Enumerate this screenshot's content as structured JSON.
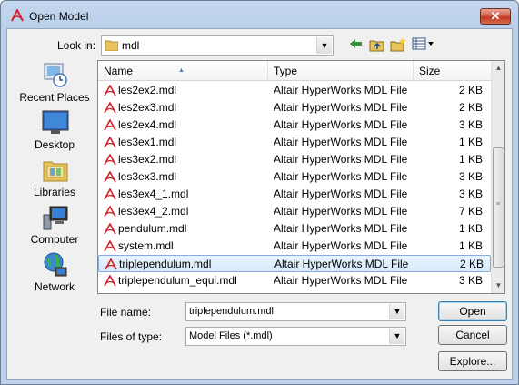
{
  "window": {
    "title": "Open Model",
    "close_label": "✕"
  },
  "lookin": {
    "label": "Look in:",
    "value": "mdl"
  },
  "toolbar": {
    "back_icon": "back-arrow-icon",
    "up_icon": "up-folder-icon",
    "new_folder_icon": "new-folder-icon",
    "view_menu_icon": "view-menu-icon"
  },
  "places": [
    {
      "label": "Recent Places",
      "icon": "recent-places-icon"
    },
    {
      "label": "Desktop",
      "icon": "desktop-icon"
    },
    {
      "label": "Libraries",
      "icon": "libraries-icon"
    },
    {
      "label": "Computer",
      "icon": "computer-icon"
    },
    {
      "label": "Network",
      "icon": "network-icon"
    }
  ],
  "columns": {
    "name": "Name",
    "type": "Type",
    "size": "Size"
  },
  "files": [
    {
      "name": "les2ex2.mdl",
      "type": "Altair HyperWorks MDL File",
      "size": "2 KB"
    },
    {
      "name": "les2ex3.mdl",
      "type": "Altair HyperWorks MDL File",
      "size": "2 KB"
    },
    {
      "name": "les2ex4.mdl",
      "type": "Altair HyperWorks MDL File",
      "size": "3 KB"
    },
    {
      "name": "les3ex1.mdl",
      "type": "Altair HyperWorks MDL File",
      "size": "1 KB"
    },
    {
      "name": "les3ex2.mdl",
      "type": "Altair HyperWorks MDL File",
      "size": "1 KB"
    },
    {
      "name": "les3ex3.mdl",
      "type": "Altair HyperWorks MDL File",
      "size": "3 KB"
    },
    {
      "name": "les3ex4_1.mdl",
      "type": "Altair HyperWorks MDL File",
      "size": "3 KB"
    },
    {
      "name": "les3ex4_2.mdl",
      "type": "Altair HyperWorks MDL File",
      "size": "7 KB"
    },
    {
      "name": "pendulum.mdl",
      "type": "Altair HyperWorks MDL File",
      "size": "1 KB"
    },
    {
      "name": "system.mdl",
      "type": "Altair HyperWorks MDL File",
      "size": "1 KB"
    },
    {
      "name": "triplependulum.mdl",
      "type": "Altair HyperWorks MDL File",
      "size": "2 KB"
    },
    {
      "name": "triplependulum_equi.mdl",
      "type": "Altair HyperWorks MDL File",
      "size": "3 KB"
    }
  ],
  "selected_index": 10,
  "filename": {
    "label": "File name:",
    "value": "triplependulum.mdl"
  },
  "filetype": {
    "label": "Files of type:",
    "value": "Model Files (*.mdl)"
  },
  "buttons": {
    "open": "Open",
    "cancel": "Cancel",
    "explore": "Explore..."
  },
  "colors": {
    "selection": "#d7e9fb",
    "selection_border": "#84acdd",
    "title_gradient": "#c4d7ee"
  }
}
